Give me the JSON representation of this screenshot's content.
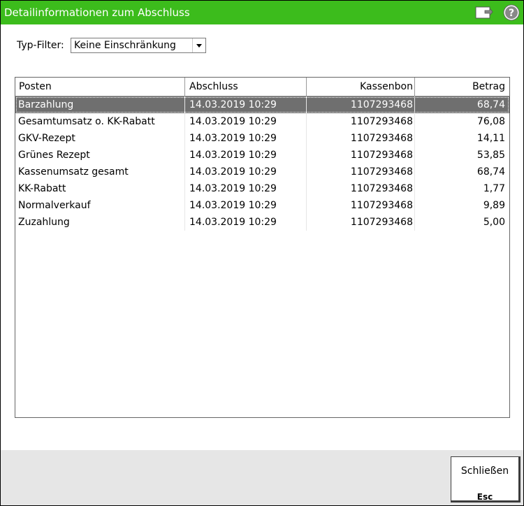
{
  "window": {
    "title": "Detailinformationen zum Abschluss",
    "icons": [
      "document-icon",
      "help-icon"
    ],
    "accent_color": "#3cbc1c"
  },
  "filter": {
    "label": "Typ-Filter:",
    "selected": "Keine Einschränkung"
  },
  "table": {
    "columns": [
      "Posten",
      "Abschluss",
      "Kassenbon",
      "Betrag"
    ],
    "rows": [
      {
        "posten": "Barzahlung",
        "abschluss": "14.03.2019 10:29",
        "kassenbon": "1107293468",
        "betrag": "68,74",
        "selected": true
      },
      {
        "posten": "Gesamtumsatz o. KK-Rabatt",
        "abschluss": "14.03.2019 10:29",
        "kassenbon": "1107293468",
        "betrag": "76,08"
      },
      {
        "posten": "GKV-Rezept",
        "abschluss": "14.03.2019 10:29",
        "kassenbon": "1107293468",
        "betrag": "14,11"
      },
      {
        "posten": "Grünes Rezept",
        "abschluss": "14.03.2019 10:29",
        "kassenbon": "1107293468",
        "betrag": "53,85"
      },
      {
        "posten": "Kassenumsatz gesamt",
        "abschluss": "14.03.2019 10:29",
        "kassenbon": "1107293468",
        "betrag": "68,74"
      },
      {
        "posten": "KK-Rabatt",
        "abschluss": "14.03.2019 10:29",
        "kassenbon": "1107293468",
        "betrag": "1,77"
      },
      {
        "posten": "Normalverkauf",
        "abschluss": "14.03.2019 10:29",
        "kassenbon": "1107293468",
        "betrag": "9,89"
      },
      {
        "posten": "Zuzahlung",
        "abschluss": "14.03.2019 10:29",
        "kassenbon": "1107293468",
        "betrag": "5,00"
      }
    ]
  },
  "footer": {
    "close_label": "Schließen",
    "close_key": "Esc"
  }
}
